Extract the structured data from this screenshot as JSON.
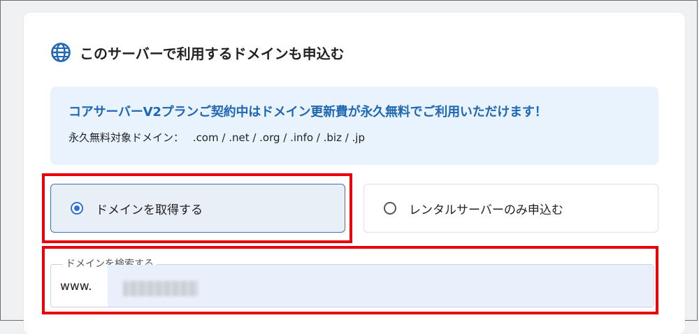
{
  "section": {
    "title": "このサーバーで利用するドメインも申込む",
    "icon": "globe-icon"
  },
  "info": {
    "headline": "コアサーバーV2プランご契約中はドメイン更新費が永久無料でご利用いただけます！",
    "sub_label": "永久無料対象ドメイン：",
    "sub_value": ".com / .net / .org / .info / .biz / .jp"
  },
  "options": [
    {
      "label": "ドメインを取得する",
      "selected": true
    },
    {
      "label": "レンタルサーバーのみ申込む",
      "selected": false
    }
  ],
  "search": {
    "legend": "ドメインを検索する",
    "prefix": "www.",
    "value": ""
  },
  "colors": {
    "accent": "#2f6fd6",
    "headline": "#1f67b3",
    "highlight": "#e8000b"
  }
}
